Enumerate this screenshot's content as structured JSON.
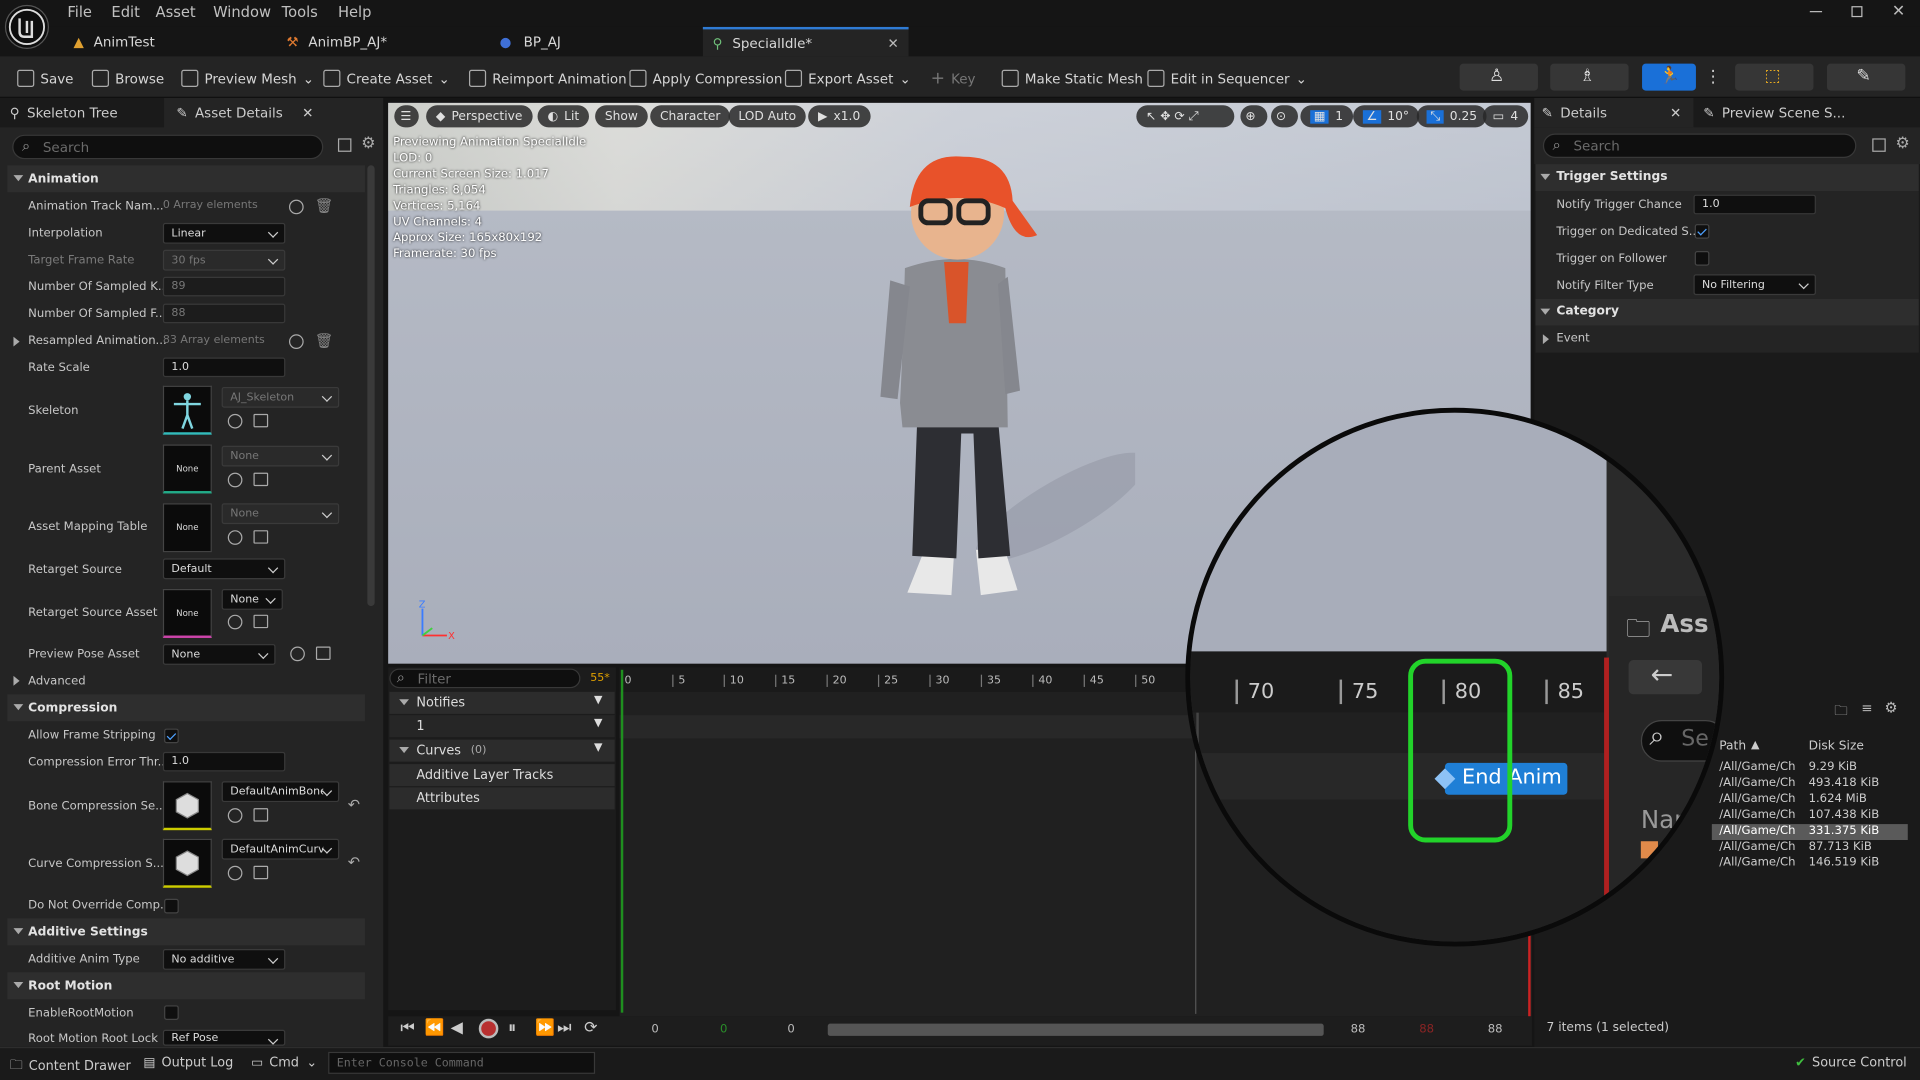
{
  "menu": [
    "File",
    "Edit",
    "Asset",
    "Window",
    "Tools",
    "Help"
  ],
  "doc_tabs": [
    {
      "label": "AnimTest"
    },
    {
      "label": "AnimBP_AJ*"
    },
    {
      "label": "BP_AJ"
    },
    {
      "label": "SpecialIdle*"
    }
  ],
  "toolbar": {
    "save": "Save",
    "browse": "Browse",
    "preview_mesh": "Preview Mesh",
    "create_asset": "Create Asset",
    "reimport": "Reimport Animation",
    "apply_compression": "Apply Compression",
    "export_asset": "Export Asset",
    "key": "Key",
    "make_static_mesh": "Make Static Mesh",
    "edit_in_sequencer": "Edit in Sequencer"
  },
  "left_tabs": {
    "skeleton_tree": "Skeleton Tree",
    "asset_details": "Asset Details"
  },
  "search_placeholder": "Search",
  "sections": {
    "animation": "Animation",
    "advanced": "Advanced",
    "compression": "Compression",
    "additive": "Additive Settings",
    "root_motion": "Root Motion"
  },
  "props": {
    "track_names": {
      "label": "Animation Track Nam...",
      "value": "0 Array elements"
    },
    "interpolation": {
      "label": "Interpolation",
      "value": "Linear"
    },
    "target_frame_rate": {
      "label": "Target Frame Rate",
      "value": "30 fps"
    },
    "sampled_keys": {
      "label": "Number Of Sampled K...",
      "value": "89"
    },
    "sampled_frames": {
      "label": "Number Of Sampled F...",
      "value": "88"
    },
    "resampled": {
      "label": "Resampled Animation...",
      "value": "83 Array elements"
    },
    "rate_scale": {
      "label": "Rate Scale",
      "value": "1.0"
    },
    "skeleton": {
      "label": "Skeleton",
      "value": "AJ_Skeleton"
    },
    "parent_asset": {
      "label": "Parent Asset",
      "value": "None",
      "thumb": "None"
    },
    "asset_mapping": {
      "label": "Asset Mapping Table",
      "value": "None",
      "thumb": "None"
    },
    "retarget_source": {
      "label": "Retarget Source",
      "value": "Default"
    },
    "retarget_source_asset": {
      "label": "Retarget Source Asset",
      "value": "None",
      "thumb": "None"
    },
    "preview_pose": {
      "label": "Preview Pose Asset",
      "value": "None"
    },
    "allow_frame_stripping": {
      "label": "Allow Frame Stripping"
    },
    "compression_error": {
      "label": "Compression Error Thr...",
      "value": "1.0"
    },
    "bone_compression": {
      "label": "Bone Compression Se...",
      "value": "DefaultAnimBone"
    },
    "curve_compression": {
      "label": "Curve Compression S...",
      "value": "DefaultAnimCurv"
    },
    "do_not_override": {
      "label": "Do Not Override Comp..."
    },
    "additive_type": {
      "label": "Additive Anim Type",
      "value": "No additive"
    },
    "enable_root_motion": {
      "label": "EnableRootMotion"
    },
    "root_motion_lock": {
      "label": "Root Motion Root Lock",
      "value": "Ref Pose"
    }
  },
  "viewport": {
    "perspective": "Perspective",
    "lit": "Lit",
    "show": "Show",
    "character": "Character",
    "lod": "LOD Auto",
    "speed": "x1.0",
    "grid": "1",
    "angle": "10°",
    "scale": "0.25",
    "cam": "4",
    "info": [
      "Previewing Animation SpecialIdle",
      "LOD: 0",
      "Current Screen Size: 1.017",
      "Triangles: 8,054",
      "Vertices: 5,164",
      "UV Channels: 4",
      "Approx Size: 165x80x192",
      "Framerate: 30 fps"
    ]
  },
  "timeline": {
    "filter": "Filter",
    "frame_badge": "55*",
    "notifies": "Notifies",
    "notify_track": "1",
    "curves": "Curves",
    "curves_count": "(0)",
    "additive_tracks": "Additive Layer Tracks",
    "attributes": "Attributes",
    "ticks": [
      "0",
      "5",
      "10",
      "15",
      "20",
      "25",
      "30",
      "35",
      "40",
      "45",
      "50"
    ],
    "bottom": {
      "a": "0",
      "b": "0",
      "c": "0",
      "d": "88",
      "e": "88",
      "f": "88"
    }
  },
  "magnifier": {
    "ticks": [
      "70",
      "75",
      "80",
      "85"
    ],
    "notify": "End Anim",
    "assets_label": "Ass",
    "search_frag": "Se",
    "name_frag": "Nar",
    "columns": {
      "path": "Path",
      "disk": "Disk Size"
    },
    "rows": [
      {
        "path": "/All/Game/Ch",
        "size": "9.29 KiB"
      },
      {
        "path": "/All/Game/Ch",
        "size": "493.418 KiB"
      },
      {
        "path": "/All/Game/Ch",
        "size": "1.624 MiB"
      },
      {
        "path": "/All/Game/Ch",
        "size": "107.438 KiB"
      },
      {
        "path": "/All/Game/Ch",
        "size": "331.375 KiB"
      },
      {
        "path": "/All/Game/Ch",
        "size": "87.713 KiB"
      },
      {
        "path": "/All/Game/Ch",
        "size": "146.519 KiB"
      }
    ]
  },
  "right": {
    "details_tab": "Details",
    "preview_tab": "Preview Scene S...",
    "search": "Search",
    "trigger_settings": "Trigger Settings",
    "notify_chance": {
      "label": "Notify Trigger Chance",
      "value": "1.0"
    },
    "dedicated": {
      "label": "Trigger on Dedicated S..."
    },
    "follower": {
      "label": "Trigger on Follower"
    },
    "filter_type": {
      "label": "Notify Filter Type",
      "value": "No Filtering"
    },
    "category": "Category",
    "event": "Event",
    "items": "7 items (1 selected)"
  },
  "status": {
    "content_drawer": "Content Drawer",
    "output_log": "Output Log",
    "cmd": "Cmd",
    "console_placeholder": "Enter Console Command",
    "source_control": "Source Control"
  },
  "colors": {
    "accent": "#2f7bd4",
    "highlight": "#22d32a",
    "notify": "#1f7fd6",
    "playhead": "#cc2222"
  }
}
